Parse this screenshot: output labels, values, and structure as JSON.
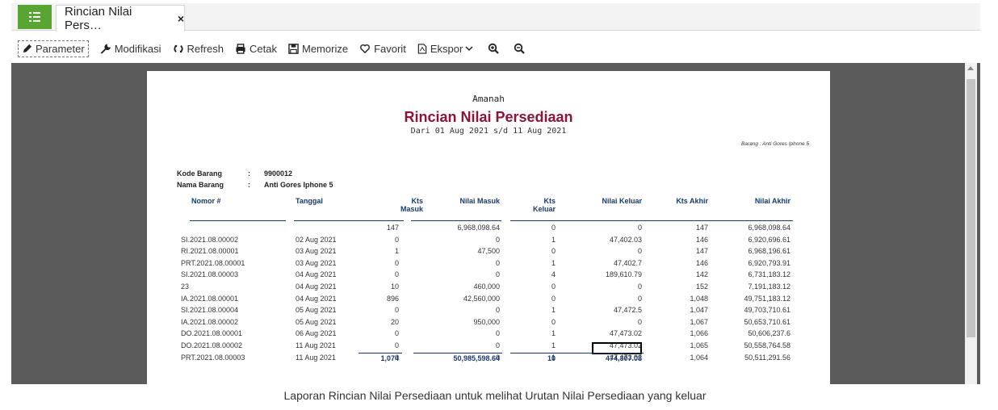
{
  "tab": {
    "title": "Rincian Nilai Pers…",
    "close": "×"
  },
  "toolbar": {
    "parameter": "Parameter",
    "modifikasi": "Modifikasi",
    "refresh": "Refresh",
    "cetak": "Cetak",
    "memorize": "Memorize",
    "favorit": "Favorit",
    "ekspor": "Ekspor"
  },
  "report": {
    "company": "Amanah",
    "title": "Rincian Nilai Persediaan",
    "period": "Dari 01 Aug 2021 s/d 11 Aug 2021",
    "filter": "Barang : Anti Gores Iphone 5",
    "kode_label": "Kode Barang",
    "kode_sep": ":",
    "kode_value": "9900012",
    "nama_label": "Nama Barang",
    "nama_sep": ":",
    "nama_value": "Anti Gores Iphone 5",
    "headers": {
      "nomor": "Nomor #",
      "tanggal": "Tanggal",
      "kts_masuk_1": "Kts",
      "kts_masuk_2": "Masuk",
      "nilai_masuk": "Nilai Masuk",
      "kts_keluar_1": "Kts",
      "kts_keluar_2": "Keluar",
      "nilai_keluar": "Nilai Keluar",
      "kts_akhir": "Kts Akhir",
      "nilai_akhir": "Nilai Akhir"
    },
    "rows": [
      {
        "nomor": "",
        "tanggal": "",
        "kts_masuk": "147",
        "nilai_masuk": "6,968,098.64",
        "kts_keluar": "0",
        "nilai_keluar": "0",
        "kts_akhir": "147",
        "nilai_akhir": "6,968,098.64"
      },
      {
        "nomor": "SI.2021.08.00002",
        "tanggal": "02 Aug 2021",
        "kts_masuk": "0",
        "nilai_masuk": "0",
        "kts_keluar": "1",
        "nilai_keluar": "47,402.03",
        "kts_akhir": "146",
        "nilai_akhir": "6,920,696.61"
      },
      {
        "nomor": "RI.2021.08.00001",
        "tanggal": "03 Aug 2021",
        "kts_masuk": "1",
        "nilai_masuk": "47,500",
        "kts_keluar": "0",
        "nilai_keluar": "0",
        "kts_akhir": "147",
        "nilai_akhir": "6,968,196.61"
      },
      {
        "nomor": "PRT.2021.08.00001",
        "tanggal": "03 Aug 2021",
        "kts_masuk": "0",
        "nilai_masuk": "0",
        "kts_keluar": "1",
        "nilai_keluar": "47,402.7",
        "kts_akhir": "146",
        "nilai_akhir": "6,920,793.91"
      },
      {
        "nomor": "SI.2021.08.00003",
        "tanggal": "04 Aug 2021",
        "kts_masuk": "0",
        "nilai_masuk": "0",
        "kts_keluar": "4",
        "nilai_keluar": "189,610.79",
        "kts_akhir": "142",
        "nilai_akhir": "6,731,183.12"
      },
      {
        "nomor": "23",
        "tanggal": "04 Aug 2021",
        "kts_masuk": "10",
        "nilai_masuk": "460,000",
        "kts_keluar": "0",
        "nilai_keluar": "0",
        "kts_akhir": "152",
        "nilai_akhir": "7,191,183.12"
      },
      {
        "nomor": "IA.2021.08.00001",
        "tanggal": "04 Aug 2021",
        "kts_masuk": "896",
        "nilai_masuk": "42,560,000",
        "kts_keluar": "0",
        "nilai_keluar": "0",
        "kts_akhir": "1,048",
        "nilai_akhir": "49,751,183.12"
      },
      {
        "nomor": "SI.2021.08.00004",
        "tanggal": "05 Aug 2021",
        "kts_masuk": "0",
        "nilai_masuk": "0",
        "kts_keluar": "1",
        "nilai_keluar": "47,472.5",
        "kts_akhir": "1,047",
        "nilai_akhir": "49,703,710.61"
      },
      {
        "nomor": "IA.2021.08.00002",
        "tanggal": "05 Aug 2021",
        "kts_masuk": "20",
        "nilai_masuk": "950,000",
        "kts_keluar": "0",
        "nilai_keluar": "0",
        "kts_akhir": "1,067",
        "nilai_akhir": "50,653,710.61"
      },
      {
        "nomor": "DO.2021.08.00001",
        "tanggal": "06 Aug 2021",
        "kts_masuk": "0",
        "nilai_masuk": "0",
        "kts_keluar": "1",
        "nilai_keluar": "47,473.02",
        "kts_akhir": "1,066",
        "nilai_akhir": "50,606,237.6"
      },
      {
        "nomor": "DO.2021.08.00002",
        "tanggal": "11 Aug 2021",
        "kts_masuk": "0",
        "nilai_masuk": "0",
        "kts_keluar": "1",
        "nilai_keluar": "47,473.02",
        "kts_akhir": "1,065",
        "nilai_akhir": "50,558,764.58"
      },
      {
        "nomor": "PRT.2021.08.00003",
        "tanggal": "11 Aug 2021",
        "kts_masuk": "0",
        "nilai_masuk": "0",
        "kts_keluar": "1",
        "nilai_keluar": "47,473.02",
        "kts_akhir": "1,064",
        "nilai_akhir": "50,511,291.56"
      }
    ],
    "totals": {
      "kts_masuk": "1,074",
      "nilai_masuk": "50,985,598.64",
      "kts_keluar": "10",
      "nilai_keluar": "474,307.08"
    }
  },
  "caption": "Laporan Rincian Nilai Persediaan untuk melihat Urutan Nilai Persediaan yang keluar",
  "colors": {
    "accent_green": "#58a531",
    "title_red": "#8a1538",
    "header_blue": "#1b3a6b",
    "viewer_bg": "#5b5b5b"
  }
}
